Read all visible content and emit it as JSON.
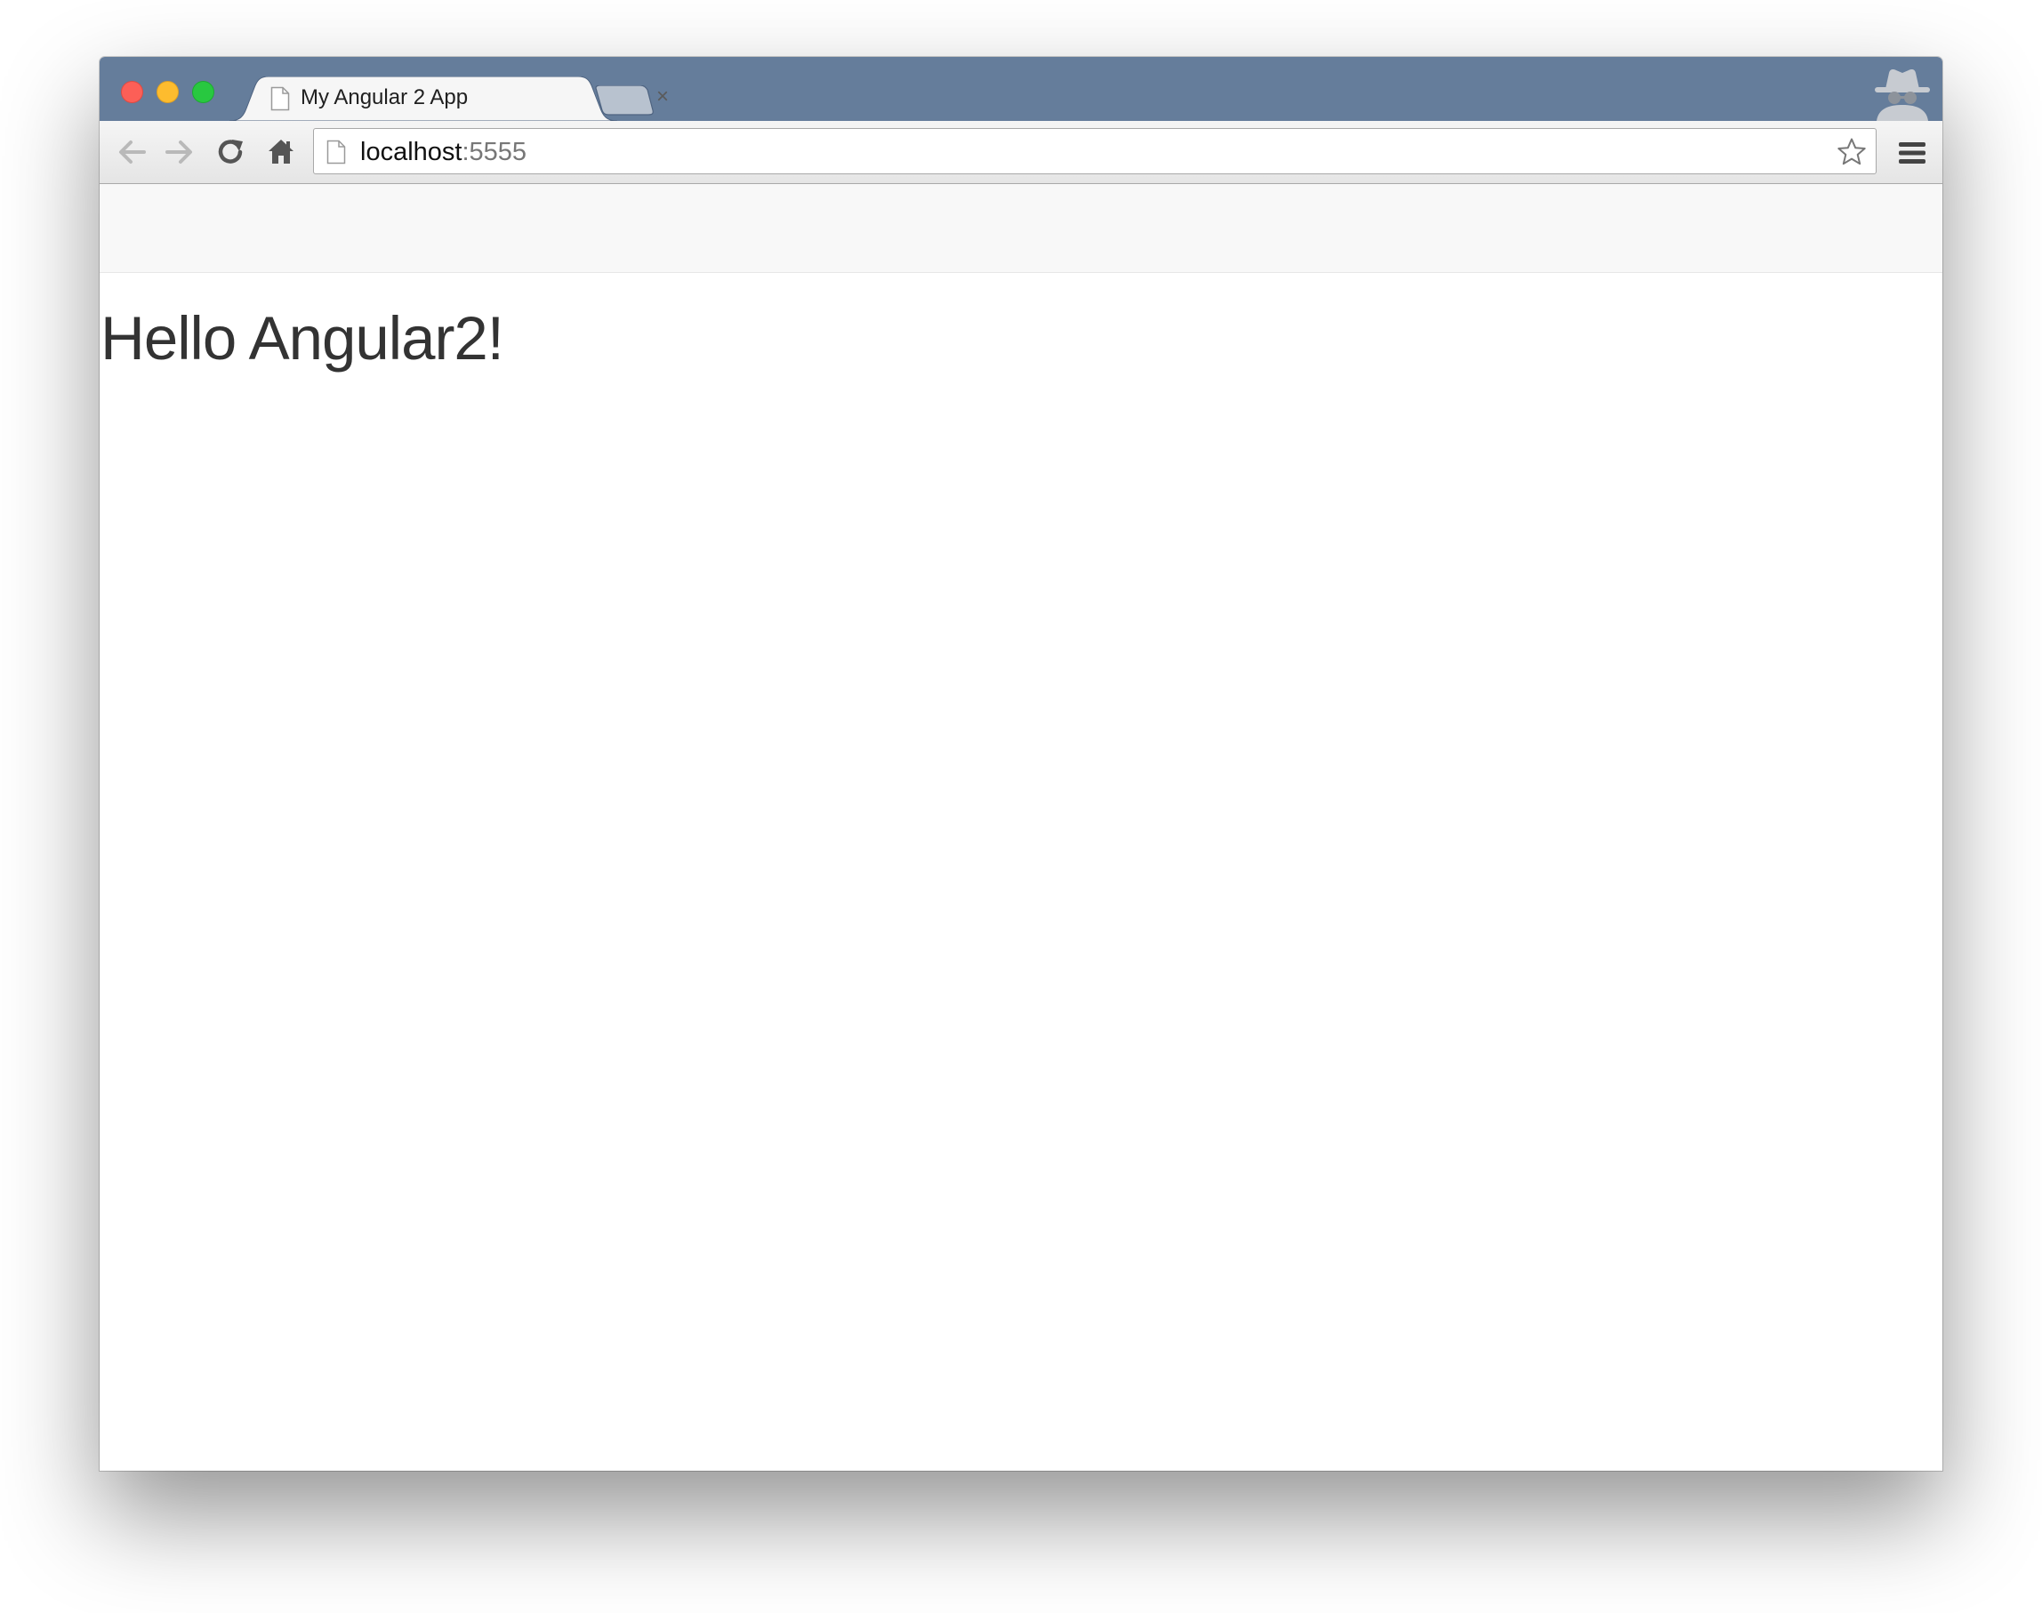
{
  "browser": {
    "tab": {
      "title": "My Angular 2 App",
      "close_symbol": "×"
    },
    "address_bar": {
      "host": "localhost",
      "port": ":5555"
    },
    "icons": {
      "window_close": "close-traffic-light",
      "window_minimize": "minimize-traffic-light",
      "window_maximize": "maximize-traffic-light",
      "favicon": "page-icon",
      "new_tab": "new-tab-icon",
      "profile": "incognito-icon",
      "back": "back-arrow-icon",
      "forward": "forward-arrow-icon",
      "reload": "reload-icon",
      "home": "home-icon",
      "bookmark": "star-icon",
      "menu": "hamburger-menu-icon"
    },
    "colors": {
      "titlebar": "#657d9b",
      "close": "#fc5f57",
      "minimize": "#fdbc2e",
      "maximize": "#28c840"
    }
  },
  "page": {
    "heading": "Hello Angular2!",
    "colors": {
      "navbar_bg": "#f8f8f8",
      "heading_text": "#333333"
    }
  }
}
